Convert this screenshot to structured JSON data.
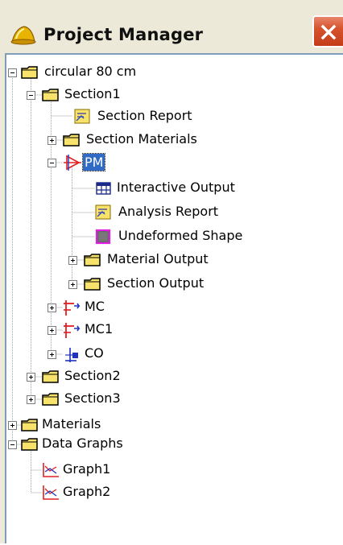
{
  "window": {
    "title": "Project Manager"
  },
  "tree": {
    "root": "circular 80 cm",
    "section1": "Section1",
    "section_report": "Section Report",
    "section_materials": "Section Materials",
    "pm": "PM",
    "interactive_output": "Interactive Output",
    "analysis_report": "Analysis Report",
    "undeformed_shape": "Undeformed Shape",
    "material_output": "Material Output",
    "section_output": "Section Output",
    "mc": "MC",
    "mc1": "MC1",
    "co": "CO",
    "section2": "Section2",
    "section3": "Section3",
    "materials": "Materials",
    "data_graphs": "Data Graphs",
    "graph1": "Graph1",
    "graph2": "Graph2"
  },
  "colors": {
    "selection": "#316ac5",
    "folder": "#f7e36b",
    "close_button": "#d6532e"
  }
}
